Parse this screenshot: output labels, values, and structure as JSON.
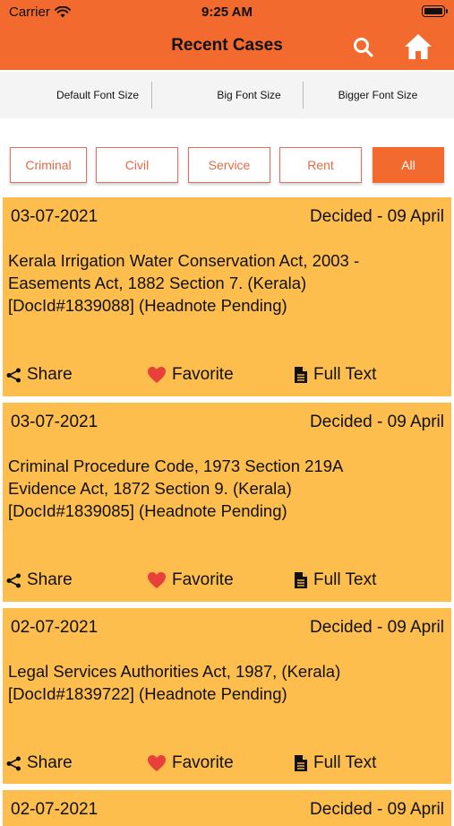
{
  "status_bar": {
    "carrier": "Carrier",
    "time": "9:25 AM"
  },
  "nav": {
    "title": "Recent Cases",
    "search_icon": "search-icon",
    "home_icon": "home-icon"
  },
  "font_options": [
    "Default Font Size",
    "Big Font Size",
    "Bigger Font Size"
  ],
  "filters": {
    "items": [
      "Criminal",
      "Civil",
      "Service",
      "Rent",
      "All"
    ],
    "selected": "All"
  },
  "colors": {
    "accent": "#f26a2e",
    "card_bg": "#fdbe4d",
    "favorite": "#e8403a"
  },
  "actions": {
    "share": "Share",
    "favorite": "Favorite",
    "full_text": "Full Text"
  },
  "cases": [
    {
      "date": "03-07-2021",
      "status": "Decided - 09 April",
      "lines": [
        "Kerala Irrigation Water Conservation Act, 2003 -",
        "Easements Act, 1882 Section 7. (Kerala)",
        "[DocId#1839088] (Headnote Pending)"
      ]
    },
    {
      "date": "03-07-2021",
      "status": "Decided - 09 April",
      "lines": [
        "Criminal Procedure Code, 1973 Section 219A",
        "Evidence Act, 1872 Section 9. (Kerala)",
        "[DocId#1839085] (Headnote Pending)"
      ]
    },
    {
      "date": "02-07-2021",
      "status": "Decided - 09 April",
      "lines": [
        "Legal Services Authorities Act, 1987, (Kerala)",
        "[DocId#1839722] (Headnote Pending)"
      ]
    },
    {
      "date": "02-07-2021",
      "status": "Decided - 09 April",
      "lines": []
    }
  ]
}
